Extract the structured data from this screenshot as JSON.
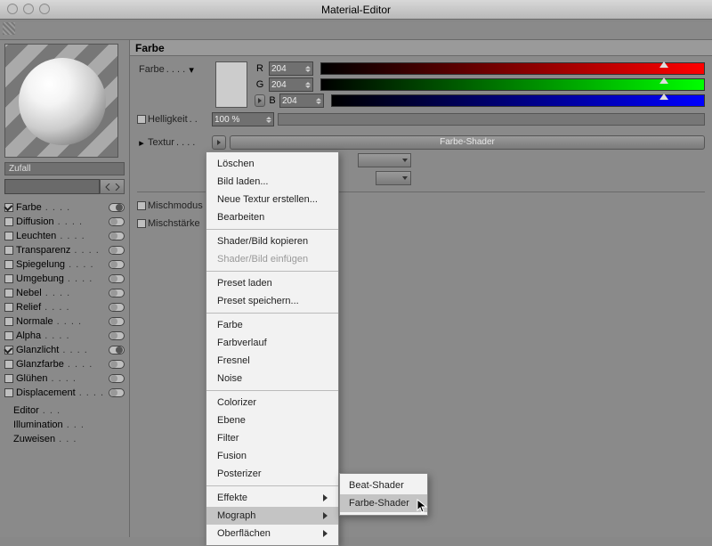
{
  "window": {
    "title": "Material-Editor"
  },
  "material_name": "Zufall",
  "channels": [
    {
      "key": "farbe",
      "label": "Farbe",
      "on": true
    },
    {
      "key": "diffusion",
      "label": "Diffusion",
      "on": false
    },
    {
      "key": "leuchten",
      "label": "Leuchten",
      "on": false
    },
    {
      "key": "transparenz",
      "label": "Transparenz",
      "on": false
    },
    {
      "key": "spiegelung",
      "label": "Spiegelung",
      "on": false
    },
    {
      "key": "umgebung",
      "label": "Umgebung",
      "on": false
    },
    {
      "key": "nebel",
      "label": "Nebel",
      "on": false
    },
    {
      "key": "relief",
      "label": "Relief",
      "on": false
    },
    {
      "key": "normale",
      "label": "Normale",
      "on": false
    },
    {
      "key": "alpha",
      "label": "Alpha",
      "on": false
    },
    {
      "key": "glanzlicht",
      "label": "Glanzlicht",
      "on": true
    },
    {
      "key": "glanzfarbe",
      "label": "Glanzfarbe",
      "on": false
    },
    {
      "key": "gluehen",
      "label": "Glühen",
      "on": false
    },
    {
      "key": "displacement",
      "label": "Displacement",
      "on": false
    }
  ],
  "extra_links": [
    {
      "key": "editor",
      "label": "Editor"
    },
    {
      "key": "illumination",
      "label": "Illumination"
    },
    {
      "key": "zuweisen",
      "label": "Zuweisen"
    }
  ],
  "section": {
    "title": "Farbe",
    "color_label": "Farbe",
    "r_label": "R",
    "g_label": "G",
    "b_label": "B",
    "r": "204",
    "g": "204",
    "b": "204",
    "brightness_label": "Helligkeit",
    "brightness_value": "100 %",
    "texture_label": "Textur",
    "texture_name": "Farbe-Shader",
    "mix_mode_label": "Mischmodus",
    "mix_strength_label": "Mischstärke"
  },
  "context_menu": {
    "groups": [
      [
        "Löschen",
        "Bild laden...",
        "Neue Textur erstellen...",
        "Bearbeiten"
      ],
      [
        "Shader/Bild kopieren",
        {
          "label": "Shader/Bild einfügen",
          "disabled": true
        }
      ],
      [
        "Preset laden",
        "Preset speichern..."
      ],
      [
        "Farbe",
        "Farbverlauf",
        "Fresnel",
        "Noise"
      ],
      [
        "Colorizer",
        "Ebene",
        "Filter",
        "Fusion",
        "Posterizer"
      ],
      [
        {
          "label": "Effekte",
          "sub": true
        },
        {
          "label": "Mograph",
          "sub": true,
          "hover": true
        },
        {
          "label": "Oberflächen",
          "sub": true
        }
      ]
    ]
  },
  "submenu": {
    "items": [
      {
        "label": "Beat-Shader"
      },
      {
        "label": "Farbe-Shader",
        "hover": true
      }
    ]
  }
}
